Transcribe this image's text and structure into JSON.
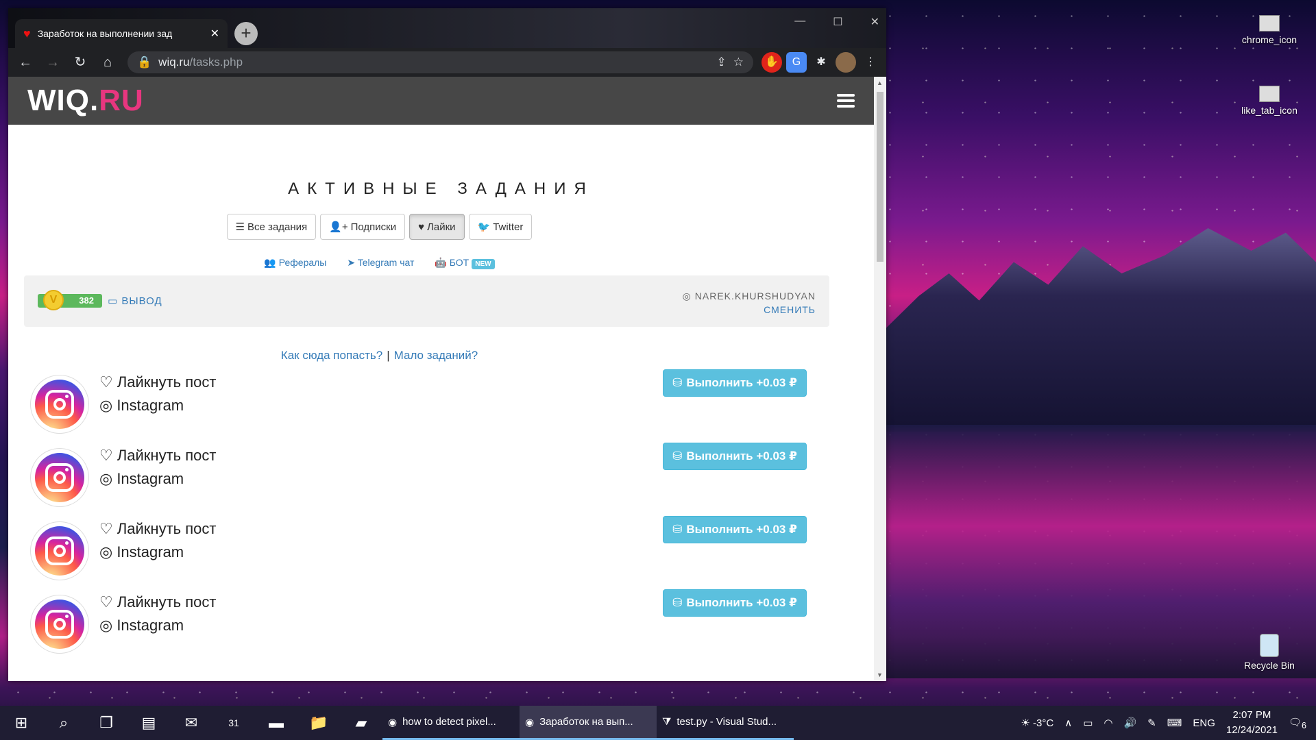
{
  "desktop": {
    "icons": [
      {
        "label": "chrome_icon"
      },
      {
        "label": "like_tab_icon"
      },
      {
        "label": "Recycle Bin"
      }
    ]
  },
  "browser": {
    "tab_title": "Заработок на выполнении зад",
    "url_domain": "wiq.ru",
    "url_path": "/tasks.php"
  },
  "site": {
    "logo_main": "WIQ.",
    "logo_accent": "RU",
    "heading": "АКТИВНЫЕ ЗАДАНИЯ",
    "filters": [
      {
        "icon": "☰",
        "label": "Все задания"
      },
      {
        "icon": "👤+",
        "label": "Подписки"
      },
      {
        "icon": "♥",
        "label": "Лайки"
      },
      {
        "icon": "🐦",
        "label": "Twitter"
      }
    ],
    "links": {
      "referrals": "Рефералы",
      "telegram": "Telegram чат",
      "bot": "БОТ",
      "new_badge": "NEW"
    },
    "balance": "382",
    "withdraw": "ВЫВОД",
    "username": "NAREK.KHURSHUDYAN",
    "change": "СМЕНИТЬ",
    "help_link": "Как сюда попасть?",
    "few_tasks_link": "Мало заданий?",
    "tasks": [
      {
        "action": "Лайкнуть пост",
        "network": "Instagram",
        "button": "Выполнить +0.03 ₽"
      },
      {
        "action": "Лайкнуть пост",
        "network": "Instagram",
        "button": "Выполнить +0.03 ₽"
      },
      {
        "action": "Лайкнуть пост",
        "network": "Instagram",
        "button": "Выполнить +0.03 ₽"
      },
      {
        "action": "Лайкнуть пост",
        "network": "Instagram",
        "button": "Выполнить +0.03 ₽"
      }
    ]
  },
  "taskbar": {
    "apps": [
      {
        "label": "how to detect pixel..."
      },
      {
        "label": "Заработок на вып..."
      },
      {
        "label": "test.py - Visual Stud..."
      }
    ],
    "weather": "-3°C",
    "lang": "ENG",
    "time": "2:07 PM",
    "date": "12/24/2021",
    "notifications": "6",
    "calendar_day": "31"
  },
  "colors": {
    "accent": "#e8367f",
    "btn": "#5bc0de",
    "navbar": "#474747",
    "link": "#337ab7"
  }
}
